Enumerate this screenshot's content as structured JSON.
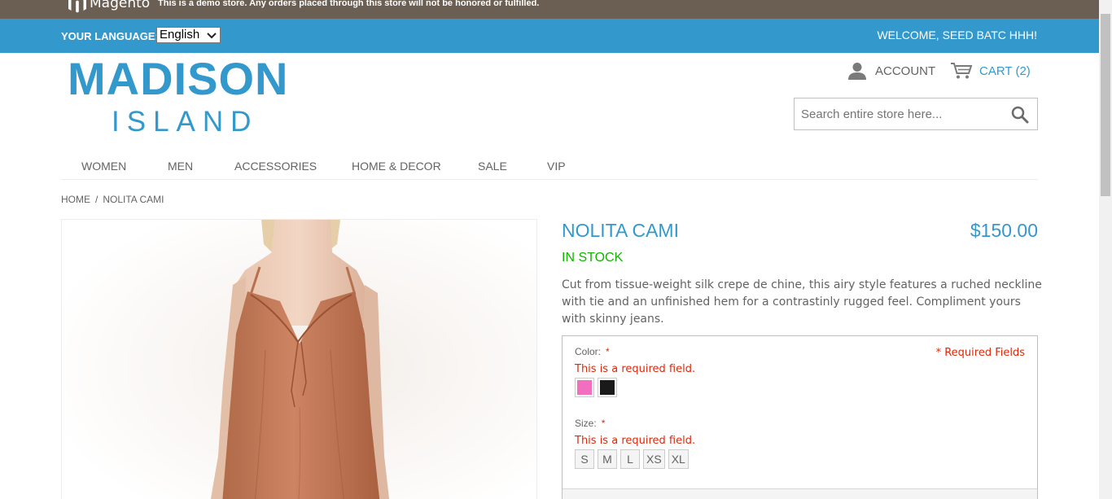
{
  "demo_notice": {
    "logo_text": "Magento",
    "message": "This is a demo store. Any orders placed through this store will not be honored or fulfilled."
  },
  "header_bar": {
    "language_label": "YOUR LANGUAGE:",
    "language_selected": "English",
    "welcome": "WELCOME, SEED BATC HHH!"
  },
  "logo": {
    "main": "MADISON",
    "sub": "ISLAND"
  },
  "account": {
    "account_label": "ACCOUNT",
    "cart_label": "CART (2)"
  },
  "search": {
    "placeholder": "Search entire store here..."
  },
  "nav": {
    "items": [
      "WOMEN",
      "MEN",
      "ACCESSORIES",
      "HOME & DECOR",
      "SALE",
      "VIP"
    ]
  },
  "breadcrumb": {
    "home": "HOME",
    "separator": "/",
    "current": "NOLITA CAMI"
  },
  "product": {
    "name": "NOLITA CAMI",
    "price": "$150.00",
    "stock": "IN STOCK",
    "description": "Cut from tissue-weight silk crepe de chine, this airy style features a ruched neckline with tie and an unfinished hem for a contrastinly rugged feel. Compliment yours with skinny jeans."
  },
  "options": {
    "required_note": "* Required Fields",
    "color_label": "Color:",
    "size_label": "Size:",
    "required_mark": "*",
    "color_error": "This is a required field.",
    "size_error": "This is a required field.",
    "colors": [
      "#f26fbf",
      "#1a1a1a"
    ],
    "sizes": [
      "S",
      "M",
      "L",
      "XS",
      "XL"
    ]
  },
  "colors": {
    "accent": "#3399cc",
    "demo_bar": "#6b5e52",
    "stock": "#11b400",
    "error": "#df280a"
  }
}
